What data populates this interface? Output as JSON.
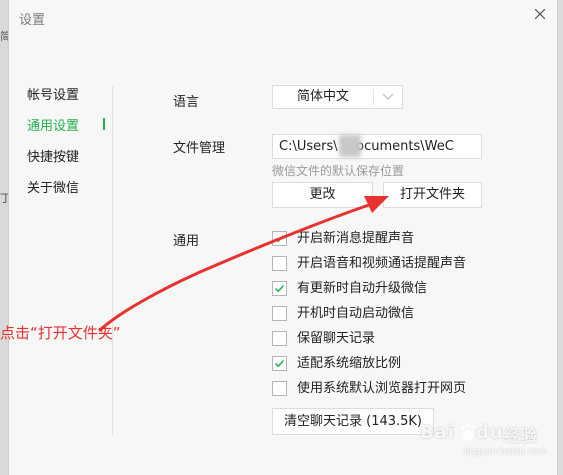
{
  "window": {
    "title": "设置"
  },
  "sidebar": {
    "items": [
      {
        "label": "帐号设置",
        "active": false
      },
      {
        "label": "通用设置",
        "active": true
      },
      {
        "label": "快捷按键",
        "active": false
      },
      {
        "label": "关于微信",
        "active": false
      }
    ]
  },
  "language": {
    "label": "语言",
    "value": "简体中文"
  },
  "file_management": {
    "label": "文件管理",
    "path": "C:\\Users\\    \\Documents\\WeC",
    "hint": "微信文件的默认保存位置",
    "change_button": "更改",
    "open_folder_button": "打开文件夹"
  },
  "general": {
    "label": "通用",
    "options": [
      {
        "label": "开启新消息提醒声音",
        "checked": true
      },
      {
        "label": "开启语音和视频通话提醒声音",
        "checked": false
      },
      {
        "label": "有更新时自动升级微信",
        "checked": true
      },
      {
        "label": "开机时自动启动微信",
        "checked": false
      },
      {
        "label": "保留聊天记录",
        "checked": false
      },
      {
        "label": "适配系统缩放比例",
        "checked": true
      },
      {
        "label": "使用系统默认浏览器打开网页",
        "checked": false
      }
    ],
    "clear_history_button": "清空聊天记录 (143.5K)"
  },
  "annotation": {
    "text": "点击“打开文件夹”"
  },
  "background": {
    "left_char_1": "简",
    "left_char_2": "丁"
  },
  "watermark": {
    "brand": "Bai",
    "paw": "du",
    "cn": "经验",
    "sub": "jingyan.baidu.com"
  },
  "colors": {
    "accent": "#21b14f",
    "annotation": "#e8322f"
  }
}
